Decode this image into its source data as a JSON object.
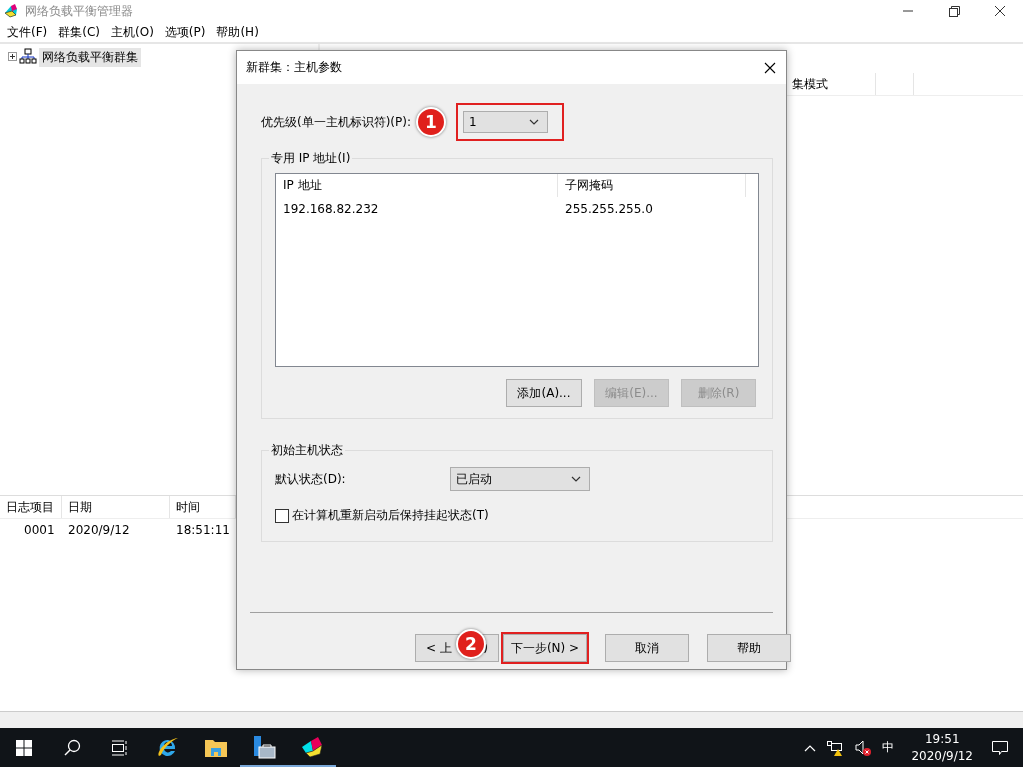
{
  "window": {
    "title": "网络负载平衡管理器",
    "menu": [
      "文件(F)",
      "群集(C)",
      "主机(O)",
      "选项(P)",
      "帮助(H)"
    ]
  },
  "tree": [
    {
      "label": "网络负载平衡群集",
      "expanded": false,
      "selected": true
    }
  ],
  "cluster_list": {
    "columns": [
      "集模式"
    ]
  },
  "log": {
    "columns": [
      "日志项目",
      "日期",
      "时间"
    ],
    "rows": [
      [
        "0001",
        "2020/9/12",
        "18:51:11"
      ]
    ]
  },
  "dialog": {
    "title": "新群集：主机参数",
    "priority": {
      "label": "优先级(单一主机标识符)(P):",
      "value": "1",
      "badge": "1",
      "outlined": true
    },
    "dedicated_ip": {
      "title": "专用 IP 地址(I)",
      "columns": [
        "IP 地址",
        "子网掩码"
      ],
      "rows": [
        [
          "192.168.82.232",
          "255.255.255.0"
        ]
      ],
      "buttons": [
        {
          "label": "添加(A)...",
          "disabled": false
        },
        {
          "label": "编辑(E)...",
          "disabled": true
        },
        {
          "label": "删除(R)",
          "disabled": true
        }
      ]
    },
    "initial_state": {
      "title": "初始主机状态",
      "default_label": "默认状态(D):",
      "default_value": "已启动",
      "suspend": {
        "label": "在计算机重新启动后保持挂起状态(T)",
        "checked": false
      }
    },
    "buttons": [
      {
        "label": "< 上",
        "tail": ")",
        "badge": "2",
        "outlined": false
      },
      {
        "label": "下一步(N) >",
        "outlined": true
      },
      {
        "label": "取消",
        "outlined": false
      },
      {
        "label": "帮助",
        "outlined": false
      }
    ]
  },
  "taskbar": {
    "ime": "中",
    "time": "19:51",
    "date": "2020/9/12"
  }
}
